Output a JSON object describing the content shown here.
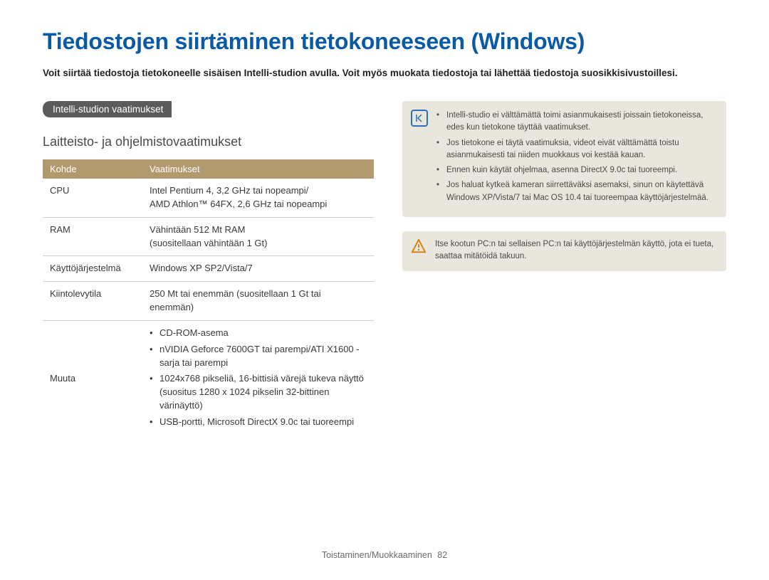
{
  "title": "Tiedostojen siirtäminen tietokoneeseen (Windows)",
  "intro": "Voit siirtää tiedostoja tietokoneelle sisäisen Intelli-studion avulla. Voit myös muokata tiedostoja tai lähettää tiedostoja suosikkisivustoillesi.",
  "section_label": "Intelli-studion vaatimukset",
  "subtitle": "Laitteisto- ja ohjelmistovaatimukset",
  "table": {
    "head": {
      "col1": "Kohde",
      "col2": "Vaatimukset"
    },
    "rows": [
      {
        "k": "CPU",
        "v": "Intel Pentium 4, 3,2 GHz tai nopeampi/\nAMD Athlon™ 64FX, 2,6 GHz tai nopeampi"
      },
      {
        "k": "RAM",
        "v": "Vähintään 512 Mt RAM\n(suositellaan vähintään 1 Gt)"
      },
      {
        "k": "Käyttöjärjestelmä",
        "v": "Windows XP SP2/Vista/7"
      },
      {
        "k": "Kiintolevytila",
        "v": "250 Mt tai enemmän (suositellaan 1 Gt tai enemmän)"
      }
    ],
    "muuta_label": "Muuta",
    "muuta_items": [
      "CD-ROM-asema",
      "nVIDIA Geforce 7600GT tai parempi/ATI X1600 -sarja tai parempi",
      "1024x768 pikseliä, 16-bittisiä värejä tukeva näyttö (suositus 1280 x 1024 pikselin 32-bittinen värinäyttö)",
      "USB-portti, Microsoft DirectX 9.0c tai tuoreempi"
    ]
  },
  "note_items": [
    "Intelli-studio ei välttämättä toimi asianmukaisesti joissain tietokoneissa, edes kun tietokone täyttää vaatimukset.",
    "Jos tietokone ei täytä vaatimuksia, videot eivät välttämättä toistu asianmukaisesti tai niiden muokkaus voi kestää kauan.",
    "Ennen kuin käytät ohjelmaa, asenna DirectX 9.0c tai tuoreempi.",
    "Jos haluat kytkeä kameran siirrettäväksi asemaksi, sinun on käytettävä Windows XP/Vista/7 tai Mac OS 10.4 tai tuoreempaa käyttöjärjestelmää."
  ],
  "warn_text": "Itse kootun PC:n tai sellaisen PC:n tai käyttöjärjestelmän käyttö, jota ei tueta, saattaa mitätöidä takuun.",
  "footer": {
    "section": "Toistaminen/Muokkaaminen",
    "page": "82"
  }
}
